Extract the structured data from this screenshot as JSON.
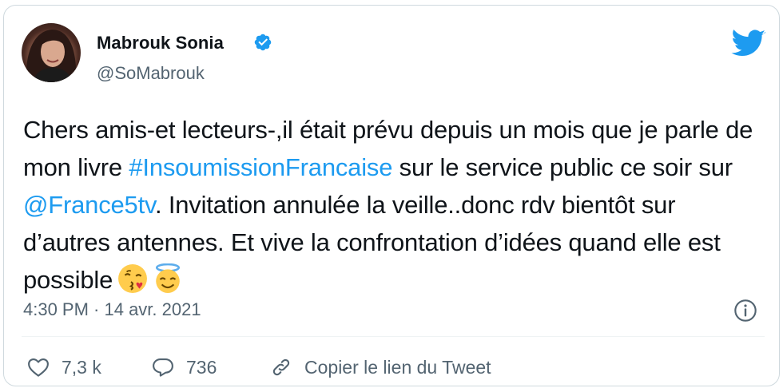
{
  "author": {
    "display_name": "Mabrouk Sonia",
    "handle": "@SoMabrouk",
    "verified": true,
    "avatar_icon": "profile-photo"
  },
  "tweet": {
    "segments": [
      {
        "text": "Chers amis-et lecteurs-,il était prévu depuis un mois que je parle de mon livre ",
        "link": false
      },
      {
        "text": "#InsoumissionFrancaise",
        "link": true
      },
      {
        "text": " sur le service public ce soir sur ",
        "link": false
      },
      {
        "text": "@France5tv",
        "link": true
      },
      {
        "text": ". Invitation annulée la veille..donc rdv bientôt sur d’autres antennes. Et vive la confrontation d’idées quand elle est possible",
        "link": false
      }
    ],
    "emojis": [
      "face-blowing-kiss-emoji",
      "smiling-face-with-halo-emoji"
    ],
    "timestamp": "4:30 PM · 14 avr. 2021"
  },
  "actions": {
    "likes": "7,3 k",
    "replies": "736",
    "copy_link_label": "Copier le lien du Tweet"
  },
  "colors": {
    "link": "#1d9bf0",
    "secondary_text": "#536471",
    "primary_text": "#0f1419",
    "border": "#cfd9de"
  },
  "icons": [
    "verified-badge-icon",
    "twitter-bird-icon",
    "info-icon",
    "heart-icon",
    "reply-bubble-icon",
    "link-icon"
  ]
}
